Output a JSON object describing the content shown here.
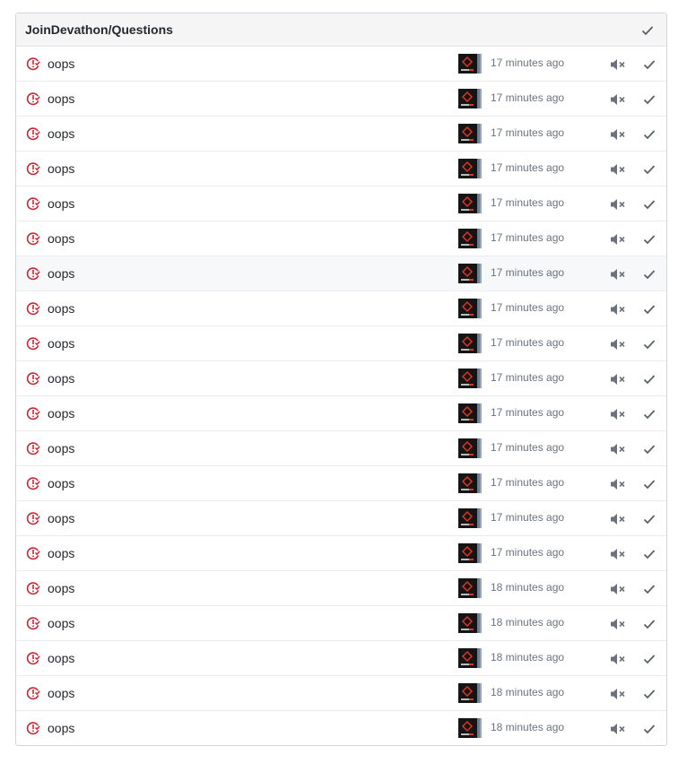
{
  "repo": {
    "title": "JoinDevathon/Questions"
  },
  "notifications": [
    {
      "title": "oops",
      "time": "17 minutes ago"
    },
    {
      "title": "oops",
      "time": "17 minutes ago"
    },
    {
      "title": "oops",
      "time": "17 minutes ago"
    },
    {
      "title": "oops",
      "time": "17 minutes ago"
    },
    {
      "title": "oops",
      "time": "17 minutes ago"
    },
    {
      "title": "oops",
      "time": "17 minutes ago"
    },
    {
      "title": "oops",
      "time": "17 minutes ago"
    },
    {
      "title": "oops",
      "time": "17 minutes ago"
    },
    {
      "title": "oops",
      "time": "17 minutes ago"
    },
    {
      "title": "oops",
      "time": "17 minutes ago"
    },
    {
      "title": "oops",
      "time": "17 minutes ago"
    },
    {
      "title": "oops",
      "time": "17 minutes ago"
    },
    {
      "title": "oops",
      "time": "17 minutes ago"
    },
    {
      "title": "oops",
      "time": "17 minutes ago"
    },
    {
      "title": "oops",
      "time": "17 minutes ago"
    },
    {
      "title": "oops",
      "time": "18 minutes ago"
    },
    {
      "title": "oops",
      "time": "18 minutes ago"
    },
    {
      "title": "oops",
      "time": "18 minutes ago"
    },
    {
      "title": "oops",
      "time": "18 minutes ago"
    },
    {
      "title": "oops",
      "time": "18 minutes ago"
    }
  ],
  "icons": {
    "type": "issue-closed-icon",
    "mute": "mute-icon",
    "done": "check-icon",
    "avatar": "user-avatar"
  },
  "colors": {
    "issue_icon": "#cb2431",
    "muted_icon": "#6a737d",
    "hover_row": "#f6f8fa"
  }
}
